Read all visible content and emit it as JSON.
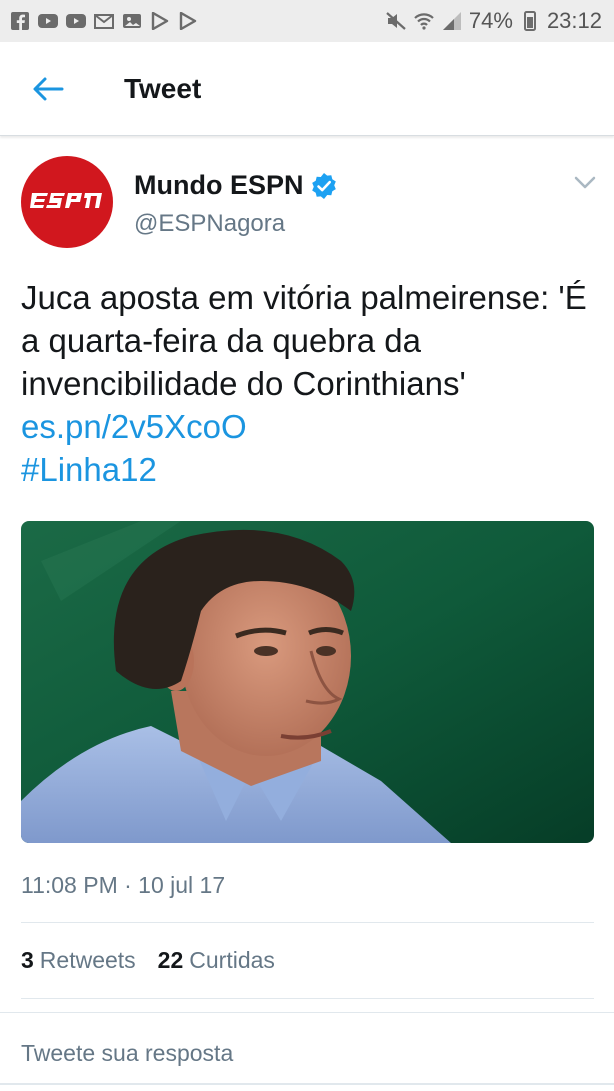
{
  "status_bar": {
    "battery_text": "74%",
    "time": "23:12",
    "left_icons": [
      "facebook-icon",
      "youtube-icon",
      "youtube-icon",
      "mail-icon",
      "photo-icon",
      "play-store-icon",
      "play-store-icon"
    ],
    "right_icons": [
      "mute-icon",
      "wifi-icon",
      "signal-icon",
      "battery-icon"
    ]
  },
  "header": {
    "title": "Tweet",
    "accent_color": "#1b95e0"
  },
  "tweet": {
    "author_name": "Mundo ESPN",
    "author_handle": "@ESPNagora",
    "avatar_text": "ESPN",
    "avatar_color": "#d1171e",
    "text_plain": "Juca aposta em vitória palmeirense: 'É a quarta-feira da quebra da invencibilidade do Corinthians'",
    "link": "es.pn/2v5XcoO",
    "hashtag": "#Linha12",
    "timestamp": "11:08 PM · 10 jul 17",
    "retweets_count": "3",
    "retweets_label": "Retweets",
    "likes_count": "22",
    "likes_label": "Curtidas"
  },
  "reply": {
    "placeholder": "Tweete sua resposta"
  }
}
